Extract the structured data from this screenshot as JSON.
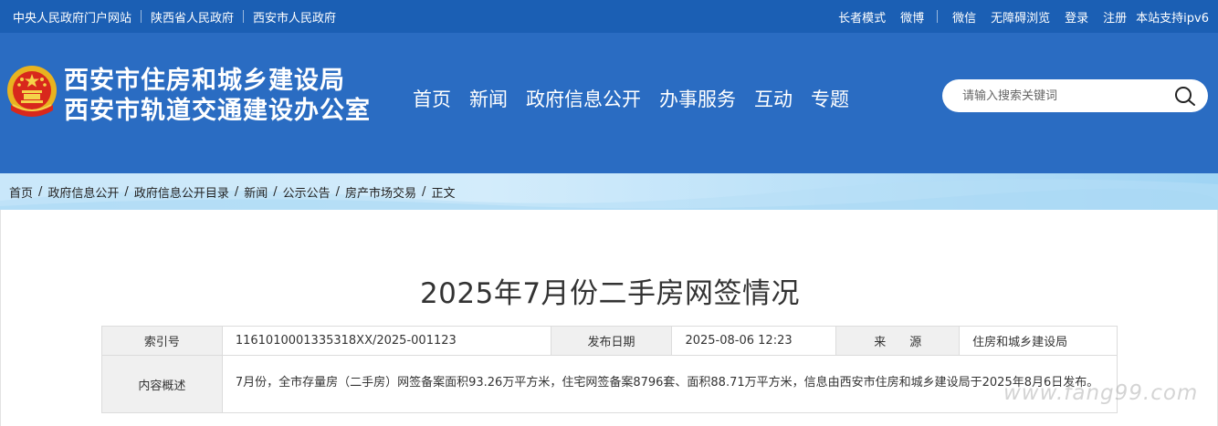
{
  "topbar": {
    "left_links": [
      "中央人民政府门户网站",
      "陕西省人民政府",
      "西安市人民政府"
    ],
    "right_links": [
      "长者模式",
      "微博",
      "微信",
      "无障碍浏览",
      "登录",
      "注册",
      "本站支持ipv6"
    ]
  },
  "header": {
    "title_line1": "西安市住房和城乡建设局",
    "title_line2": "西安市轨道交通建设办公室",
    "nav": [
      "首页",
      "新闻",
      "政府信息公开",
      "办事服务",
      "互动",
      "专题"
    ],
    "search": {
      "placeholder": "请输入搜索关键词",
      "icon": "search-icon"
    }
  },
  "breadcrumb": {
    "items": [
      "首页",
      "政府信息公开",
      "政府信息公开目录",
      "新闻",
      "公示公告",
      "房产市场交易",
      "正文"
    ],
    "separator": "/"
  },
  "article": {
    "title": "2025年7月份二手房网签情况",
    "meta": {
      "index_label": "索引号",
      "index_value": "1161010001335318XX/2025-001123",
      "date_label": "发布日期",
      "date_value": "2025-08-06 12:23",
      "source_label": "来　　源",
      "source_value": "住房和城乡建设局",
      "summary_label": "内容概述",
      "summary_value": "7月份，全市存量房（二手房）网签备案面积93.26万平方米，住宅网签备案8796套、面积88.71万平方米，信息由西安市住房和城乡建设局于2025年8月6日发布。"
    }
  },
  "watermark": "www.fang99.com",
  "colors": {
    "topbar_bg": "#1b5fb4",
    "header_bg": "#2a6cc2",
    "breadcrumb_bg": "#c9e7fa",
    "label_cell_bg": "#f0f0f0"
  }
}
